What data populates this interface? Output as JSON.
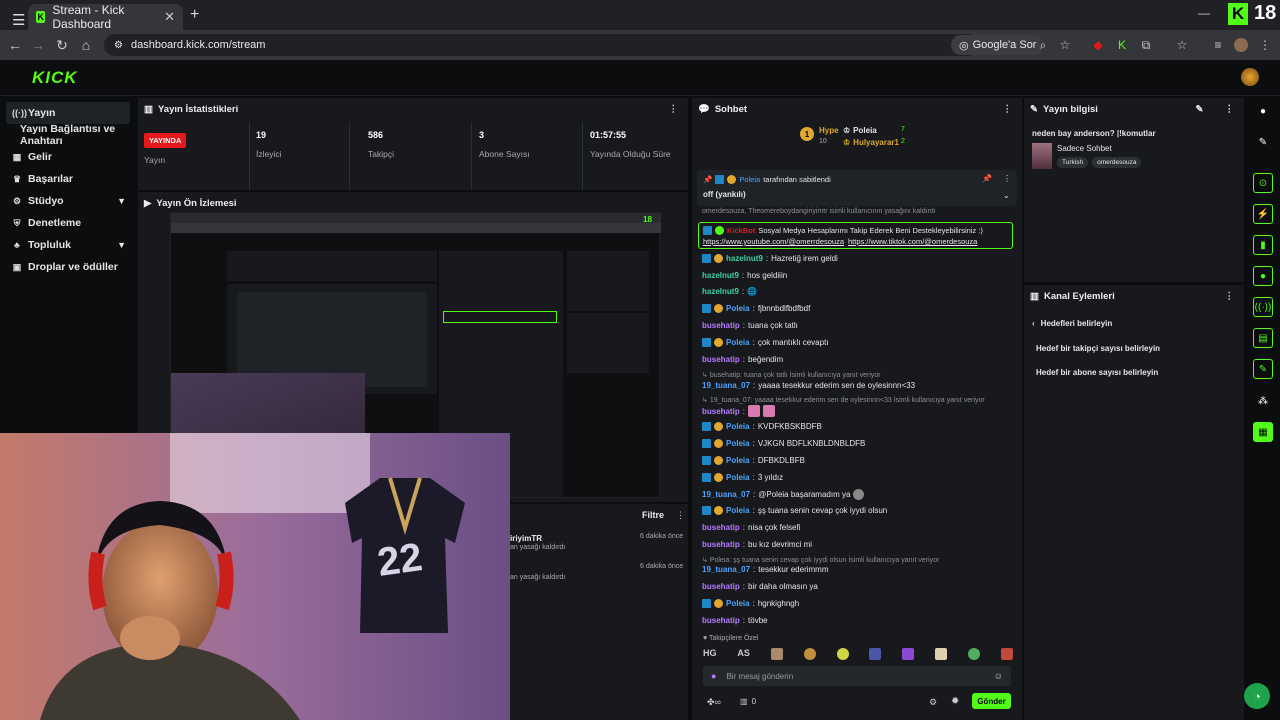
{
  "browser": {
    "tab_title": "Stream - Kick Dashboard",
    "url": "dashboard.kick.com/stream",
    "lens_label": "Google'a Sor",
    "viewer_badge": "18"
  },
  "sidebar": {
    "items": [
      {
        "label": "Yayın"
      },
      {
        "label": "Yayın Bağlantısı ve Anahtarı"
      },
      {
        "label": "Gelir"
      },
      {
        "label": "Başarılar"
      },
      {
        "label": "Stüdyo"
      },
      {
        "label": "Denetleme"
      },
      {
        "label": "Topluluk"
      },
      {
        "label": "Droplar ve ödüller"
      }
    ]
  },
  "stats": {
    "title": "Yayın İstatistikleri",
    "live_label": "YAYINDA",
    "status_label": "Yayın",
    "viewers": "19",
    "viewers_label": "İzleyici",
    "followers": "586",
    "followers_label": "Takipçi",
    "subs": "3",
    "subs_label": "Abone Sayısı",
    "uptime": "01:57:55",
    "uptime_label": "Yayında Olduğu Süre"
  },
  "preview": {
    "title": "Yayın Ön İzlemesi",
    "badge": "18"
  },
  "activity": {
    "filter_label": "Filtre",
    "rows": [
      {
        "text": "iriyimTR",
        "sub": "an yasağı kaldırdı",
        "time": "6 dakika önce"
      },
      {
        "text": "",
        "sub": "an yasağı kaldırdı",
        "time": "6 dakika önce"
      }
    ]
  },
  "chat": {
    "title": "Sohbet",
    "hype_label": "Hype",
    "hype_count": "10",
    "leaders": [
      {
        "name": "Poleia",
        "count": "7"
      },
      {
        "name": "Hulyayarar1",
        "count": "2"
      }
    ],
    "pinned_by": "Poleia",
    "pinned_suffix": "tarafından sabitlendi",
    "pinned_text": "off (yankılı)",
    "ban_notice": "omerdesouza, Theomereboydangiriyimtr isimli kullanıcının yasağını kaldırdı",
    "kickbot_name": "KickBot",
    "kickbot_text": "Sosyal Medya Hesaplarımı Takip Ederek Beni Destekleyebilirsiniz :)",
    "kickbot_link1": "https://www.youtube.com/@omerrdesouza",
    "kickbot_link2": "https://www.tiktok.com/@omerdesouza",
    "messages": [
      {
        "user": "hazelnut9",
        "text": "Hazretiğ irem geldi",
        "badges": true,
        "color": "#3fd1a1"
      },
      {
        "user": "hazelnut9",
        "text": "hos geldiiin",
        "badges": false,
        "color": "#3fd1a1"
      },
      {
        "user": "hazelnut9",
        "text": "",
        "badges": false,
        "color": "#3fd1a1"
      },
      {
        "user": "Poleia",
        "text": "fjbnnbdlfbdfbdf",
        "badges": true,
        "color": "#4da3ff"
      },
      {
        "user": "busehatip",
        "text": "tuana çok tatlı",
        "badges": false,
        "color": "#b67cff"
      },
      {
        "user": "Poleia",
        "text": "çok mantıklı cevaptı",
        "badges": true,
        "color": "#4da3ff"
      },
      {
        "user": "busehatip",
        "text": "beğendim",
        "badges": false,
        "color": "#b67cff"
      }
    ],
    "reply1": "busehatip: tuana çok tatlı İsimli kullanıcıya yanıt veriyor",
    "msg_tuana1_user": "19_tuana_07",
    "msg_tuana1_text": "yaaaa tesekkur ederim sen de oylesinnn<33",
    "reply2": "19_tuana_07: yaaaa tesekkur ederim sen de oylesinnn<33 İsimli kullanıcıya yanıt veriyor",
    "msg_buse_emote_user": "busehatip",
    "messages2": [
      {
        "user": "Poleia",
        "text": "KVDFKBSKBDFB"
      },
      {
        "user": "Poleia",
        "text": "VJKGN BDFLKNBLDNBLDFB"
      },
      {
        "user": "Poleia",
        "text": "DFBKDLBFB"
      },
      {
        "user": "Poleia",
        "text": "3 yıldız"
      }
    ],
    "msg_tuana2_user": "19_tuana_07",
    "msg_tuana2_text": "@Poleia başaramadım ya",
    "msg_poleia5_user": "Poleia",
    "msg_poleia5_text": "şş tuana senin cevap çok iyydi olsun",
    "msg_buse3_user": "busehatip",
    "msg_buse3_text": "nisa çok felsefi",
    "msg_buse4_user": "busehatip",
    "msg_buse4_text": "bu kız devrimci mi",
    "reply3": "Poleia: şş tuana senin cevap çok iyydi olsun İsimli kullanıcıya yanıt veriyor",
    "msg_tuana3_user": "19_tuana_07",
    "msg_tuana3_text": "tesekkur ederimmm",
    "msg_buse5_user": "busehatip",
    "msg_buse5_text": "bir daha olmasın ya",
    "msg_poleia6_user": "Poleia",
    "msg_poleia6_text": "hgnkighngh",
    "msg_buse6_user": "busehatip",
    "msg_buse6_text": "tövbe",
    "emote_section": "Takipçilere Özel",
    "input_placeholder": "Bir mesaj gönderin",
    "timer_count": "0",
    "send_label": "Gönder"
  },
  "stream_info": {
    "title": "Yayın bilgisi",
    "stream_title": "neden bay anderson? |!komutlar",
    "mode": "Sadece Sohbet",
    "tags": [
      "Turkish",
      "omerdesouza"
    ]
  },
  "channel_actions": {
    "title": "Kanal Eylemleri",
    "back_label": "Hedefleri belirleyin",
    "items": [
      "Hedef bir takipçi sayısı belirleyin",
      "Hedef bir abone sayısı belirleyin"
    ]
  },
  "colors": {
    "accent": "#53fc18",
    "live": "#e5191c",
    "panel": "#17191c"
  }
}
